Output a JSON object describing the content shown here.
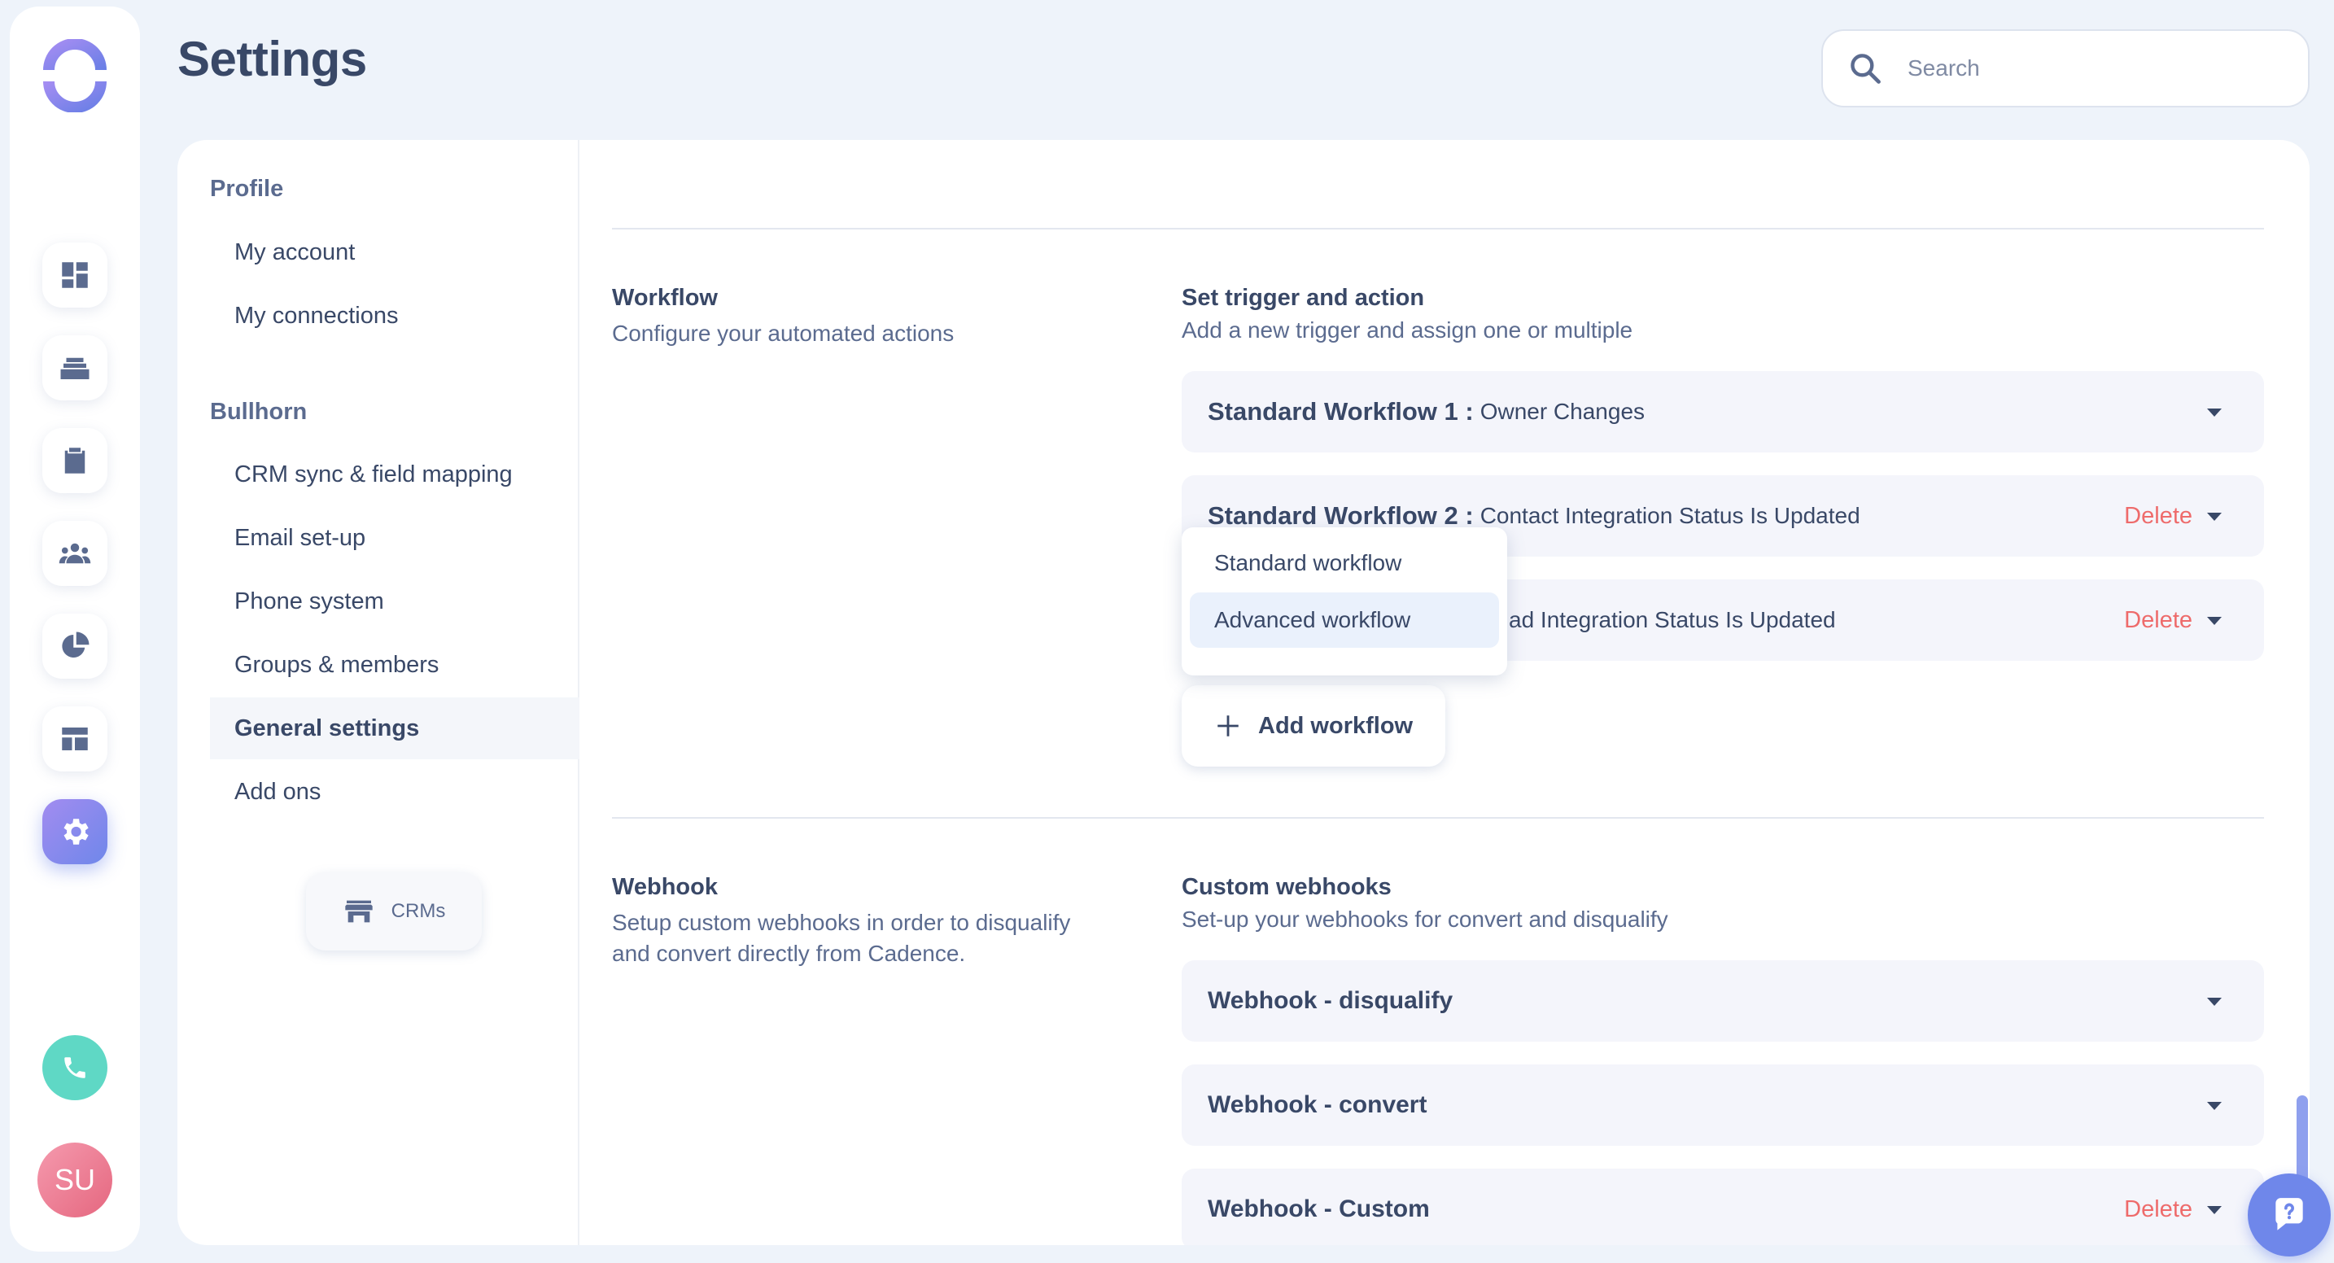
{
  "page": {
    "title": "Settings"
  },
  "search": {
    "placeholder": "Search"
  },
  "rail": {
    "icons": [
      "dashboard-icon",
      "layers-icon",
      "clipboard-icon",
      "people-icon",
      "pie-chart-icon",
      "template-icon",
      "gear-icon"
    ],
    "active": "gear-icon",
    "avatar_initials": "SU"
  },
  "nav": {
    "profile_heading": "Profile",
    "profile_items": [
      "My account",
      "My connections"
    ],
    "bullhorn_heading": "Bullhorn",
    "bullhorn_items": [
      "CRM sync & field mapping",
      "Email set-up",
      "Phone system",
      "Groups & members",
      "General settings",
      "Add ons"
    ],
    "active_item": "General settings",
    "crm_button": "CRMs"
  },
  "workflow": {
    "title": "Workflow",
    "description": "Configure your automated actions",
    "panel_title": "Set trigger and action",
    "panel_desc": "Add a new trigger and assign one or multiple",
    "items": [
      {
        "name": "Standard Workflow 1 :",
        "value": "Owner Changes",
        "delete": ""
      },
      {
        "name": "Standard Workflow 2 :",
        "value": "Contact Integration Status Is Updated",
        "delete": "Delete"
      },
      {
        "name": "",
        "value": "ad Integration Status Is Updated",
        "delete": "Delete"
      }
    ],
    "dropdown": [
      "Standard workflow",
      "Advanced workflow"
    ],
    "add_button": "Add workflow"
  },
  "webhook": {
    "title": "Webhook",
    "description_line1": "Setup custom webhooks in order to disqualify",
    "description_line2": "and convert directly from Cadence.",
    "panel_title": "Custom webhooks",
    "panel_desc": "Set-up your webhooks for convert and disqualify",
    "items": [
      {
        "name": "Webhook - disqualify",
        "delete": ""
      },
      {
        "name": "Webhook - convert",
        "delete": ""
      },
      {
        "name": "Webhook - Custom",
        "delete": "Delete"
      }
    ]
  },
  "colors": {
    "accent": "#6f87ea",
    "delete": "#ee6b6b",
    "phone": "#5fd8c5",
    "avatar": "#e5677f",
    "background": "#eef3fa"
  }
}
